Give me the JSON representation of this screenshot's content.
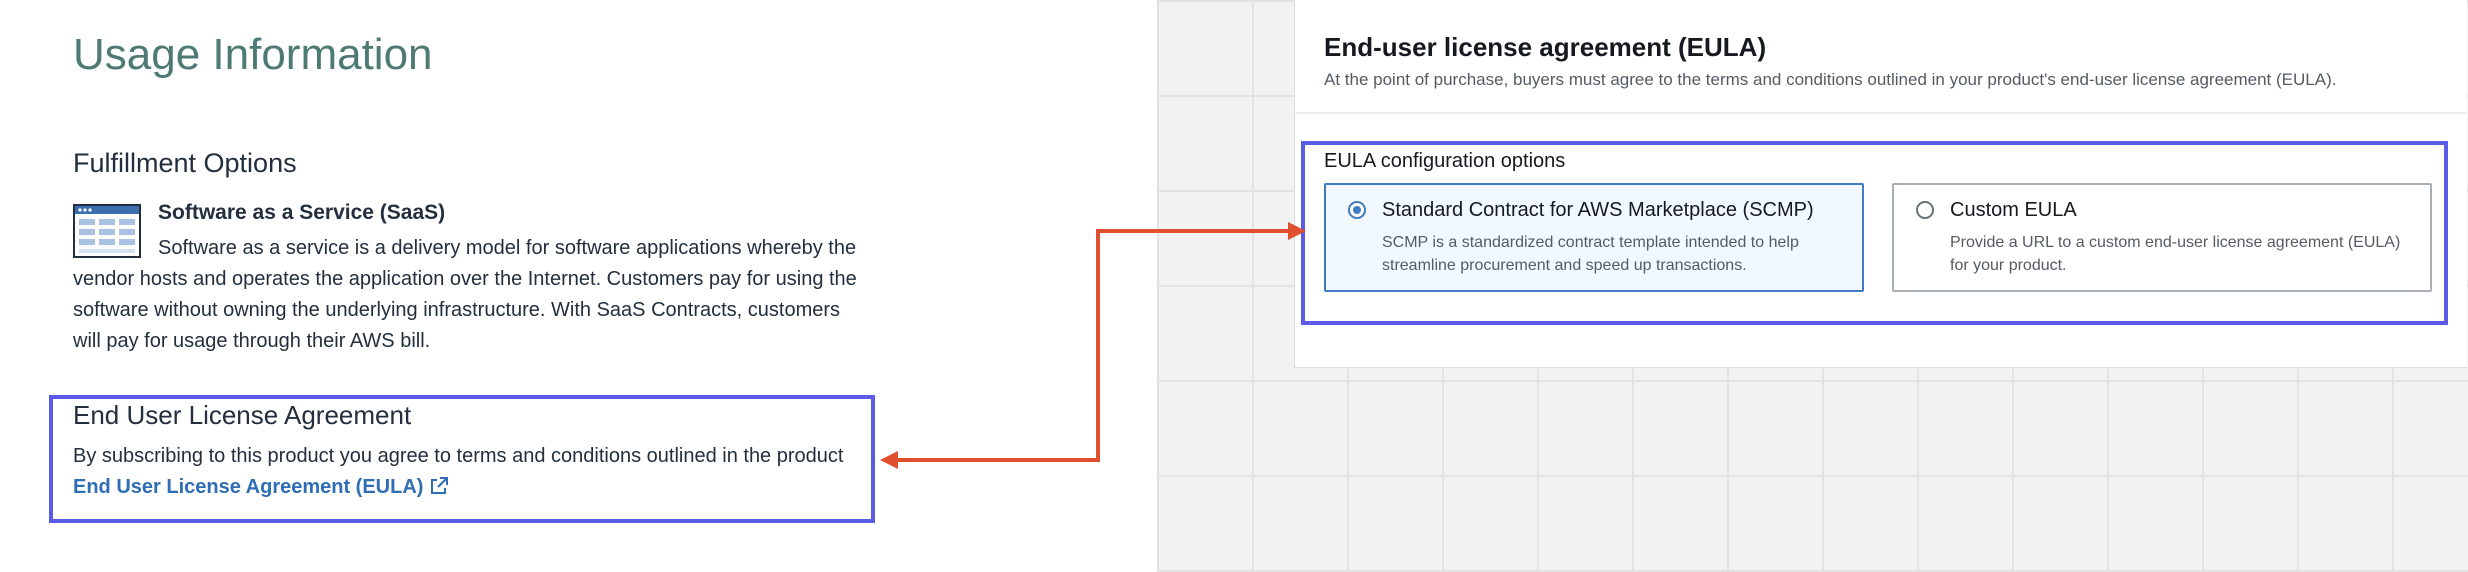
{
  "left": {
    "page_title": "Usage Information",
    "section_title": "Fulfillment Options",
    "saas": {
      "title": "Software as a Service (SaaS)",
      "description": "Software as a service is a delivery model for software applications whereby the vendor hosts and operates the application over the Internet. Customers pay for using the software without owning the underlying infrastructure. With SaaS Contracts, customers will pay for usage through their AWS bill.",
      "icon": "saas-window-icon"
    },
    "eula": {
      "heading": "End User License Agreement",
      "text": "By subscribing to this product you agree to terms and conditions outlined in the product",
      "link_label": "End User License Agreement (EULA)",
      "link_icon": "external-link-icon"
    }
  },
  "right": {
    "title": "End-user license agreement (EULA)",
    "description": "At the point of purchase, buyers must agree to the terms and conditions outlined in your product's end-user license agreement (EULA).",
    "config_label": "EULA configuration options",
    "options": [
      {
        "title": "Standard Contract for AWS Marketplace (SCMP)",
        "description": "SCMP is a standardized contract template intended to help streamline procurement and speed up transactions.",
        "selected": true
      },
      {
        "title": "Custom EULA",
        "description": "Provide a URL to a custom end-user license agreement (EULA) for your product.",
        "selected": false
      }
    ]
  },
  "colors": {
    "highlight_box": "#5b5be8",
    "arrow": "#e0502f",
    "link": "#2f6db5",
    "page_title": "#4d7a72",
    "selected_option_border": "#3f7cc0"
  }
}
